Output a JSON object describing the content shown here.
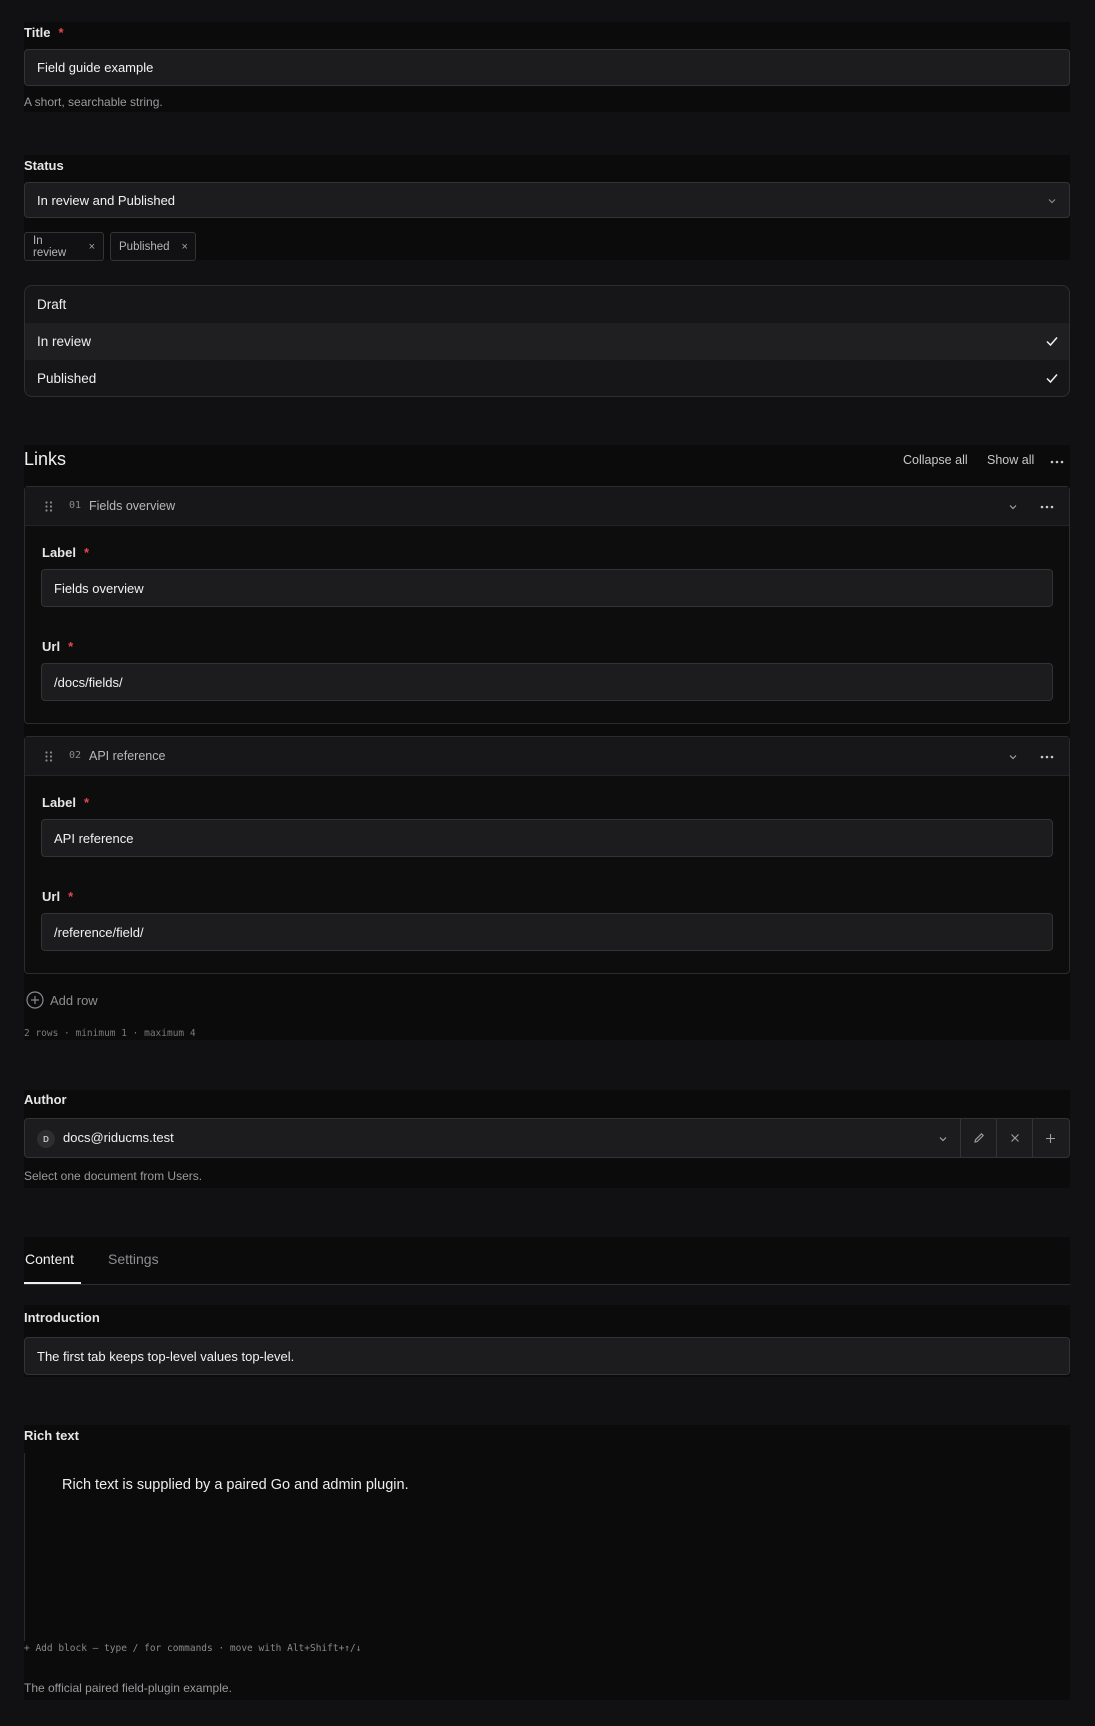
{
  "title_field": {
    "label": "Title",
    "required_mark": "*",
    "value": "Field guide example",
    "help": "A short, searchable string."
  },
  "status_field": {
    "label": "Status",
    "value": "In review and Published",
    "chips": [
      {
        "label": "In review",
        "remove": "×"
      },
      {
        "label": "Published",
        "remove": "×"
      }
    ],
    "options": [
      {
        "label": "Draft",
        "checked": false
      },
      {
        "label": "In review",
        "checked": true
      },
      {
        "label": "Published",
        "checked": true
      }
    ]
  },
  "links": {
    "heading": "Links",
    "collapse_all": "Collapse all",
    "show_all": "Show all",
    "rows": [
      {
        "number": "01",
        "title": "Fields overview",
        "label_label": "Label",
        "label_value": "Fields overview",
        "url_label": "Url",
        "url_value": "/docs/fields/"
      },
      {
        "number": "02",
        "title": "API reference",
        "label_label": "Label",
        "label_value": "API reference",
        "url_label": "Url",
        "url_value": "/reference/field/"
      }
    ],
    "add_row": "Add row",
    "summary": "2 rows · minimum 1 · maximum 4"
  },
  "author": {
    "label": "Author",
    "avatar_initial": "D",
    "value": "docs@riducms.test",
    "help": "Select one document from Users."
  },
  "tabs": [
    {
      "label": "Content",
      "active": true
    },
    {
      "label": "Settings",
      "active": false
    }
  ],
  "introduction": {
    "label": "Introduction",
    "value": "The first tab keeps top-level values top-level."
  },
  "rich_text": {
    "label": "Rich text",
    "content": "Rich text is supplied by a paired Go and admin plugin.",
    "hint": "+ Add block — type / for commands · move with Alt+Shift+↑/↓",
    "help": "The official paired field-plugin example."
  },
  "colors": {
    "background": "#111113",
    "panel": "#0b0b0c",
    "input": "#1c1c1e",
    "required": "#e5484d"
  }
}
